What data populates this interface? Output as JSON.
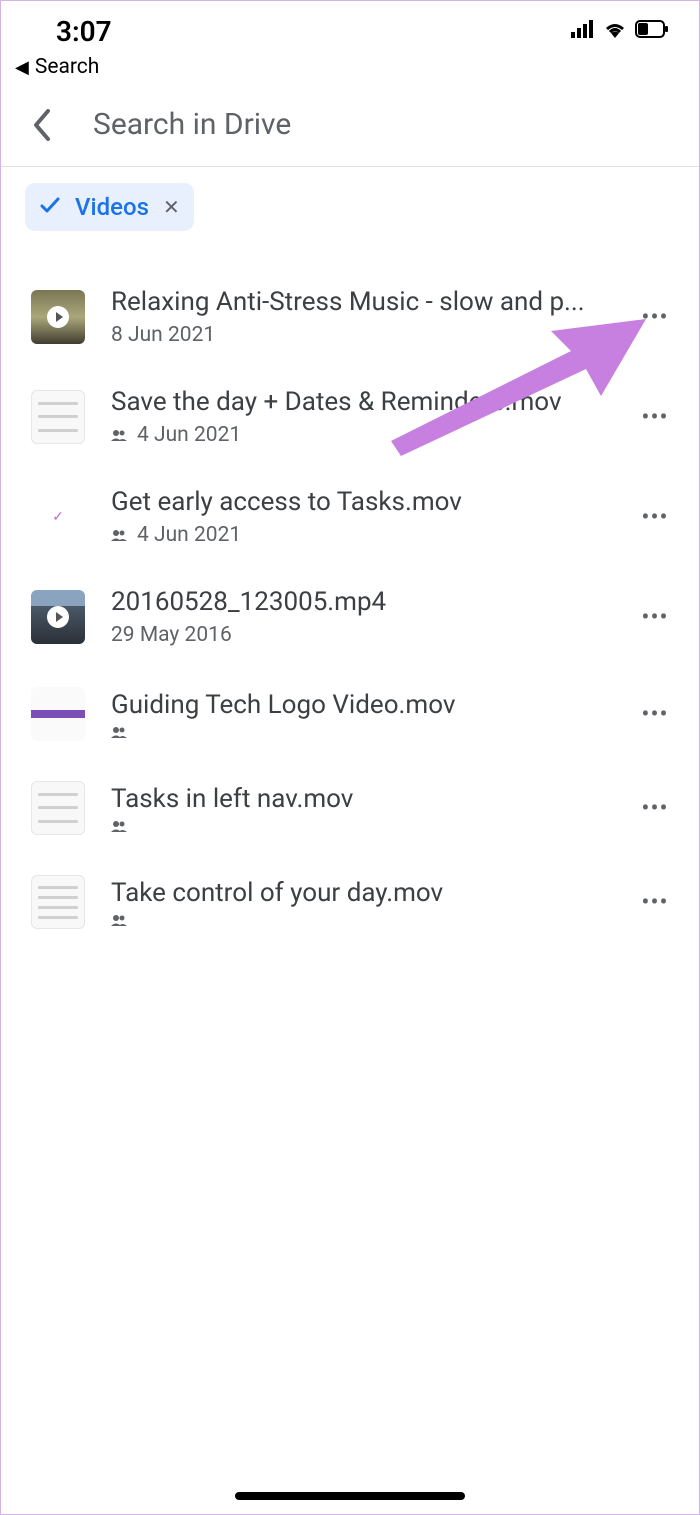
{
  "status": {
    "time": "3:07",
    "back_label": "Search"
  },
  "header": {
    "search_placeholder": "Search in Drive"
  },
  "filter": {
    "label": "Videos",
    "close_glyph": "✕"
  },
  "files": [
    {
      "title": "Relaxing Anti-Stress Music - slow and p...",
      "date": "8 Jun 2021",
      "shared": false,
      "thumb": "video-dark",
      "play": true
    },
    {
      "title": "Save the day + Dates & Reminders.mov",
      "date": "4 Jun 2021",
      "shared": true,
      "thumb": "doc",
      "play": false
    },
    {
      "title": "Get early access to Tasks.mov",
      "date": "4 Jun 2021",
      "shared": true,
      "thumb": "check",
      "play": false
    },
    {
      "title": "20160528_123005.mp4",
      "date": "29 May 2016",
      "shared": false,
      "thumb": "video-city",
      "play": true
    },
    {
      "title": "Guiding Tech Logo Video.mov",
      "date": "",
      "shared": true,
      "thumb": "doc-purple",
      "play": false
    },
    {
      "title": "Tasks in left nav.mov",
      "date": "",
      "shared": true,
      "thumb": "doc",
      "play": false
    },
    {
      "title": "Take control of your day.mov",
      "date": "",
      "shared": true,
      "thumb": "doc",
      "play": false
    }
  ],
  "more_glyph": "•••"
}
